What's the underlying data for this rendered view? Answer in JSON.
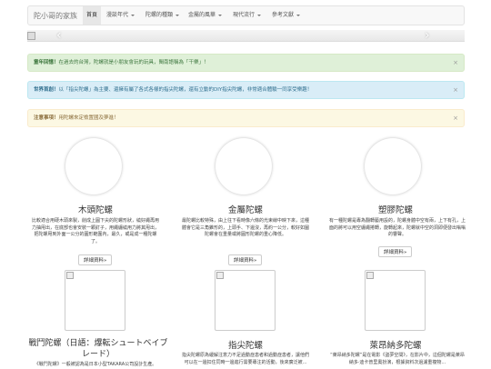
{
  "navbar": {
    "brand": "陀小哥的家族",
    "items": [
      {
        "label": "首頁",
        "dropdown": false,
        "active": true
      },
      {
        "label": "漫談年代",
        "dropdown": true
      },
      {
        "label": "陀螺的種類",
        "dropdown": true
      },
      {
        "label": "金屬的風華",
        "dropdown": true
      },
      {
        "label": "現代流行",
        "dropdown": true
      },
      {
        "label": "參考文獻",
        "dropdown": true
      }
    ]
  },
  "alerts": {
    "success": {
      "strong": "童年回憶！",
      "text": "在過去的台灣，陀螺就是小朋友會玩的玩具，閩南語稱為「干樂」！"
    },
    "info": {
      "strong": "世界首創！",
      "text": "以「指尖陀螺」為主要、還擁有屬了各式各樣的指尖陀螺，還有立動的DIY指尖陀螺，非常適合體驗一同享受樂趣！"
    },
    "warning": {
      "strong": "注意事項！",
      "text": "用陀螺來定檢置國及夢進！"
    }
  },
  "cards": [
    {
      "title": "木頭陀螺",
      "text": "比較適合用硬木頭來製，削成上圓下尖的陀螺形狀，繞好繩再用力抽甩出，在底部也會安裝一顆釘子，用繩纏繞用力將其甩出，把陀螺甩到外面一公分的圓形範圍內，最久，或是成一種陀螺了。",
      "button": "詳細資料»"
    },
    {
      "title": "金屬陀螺",
      "text": "最陀螺比較特殊，由上往下看時像六條的光束線中映下來，這種體會它是三角錐形的，上頭手、下邊沒，再約一公分，較好如圖陀螺會在重量或將圓形陀螺的重心降低。",
      "button": "詳細資料»"
    },
    {
      "title": "塑膠陀螺",
      "text": "有一種陀螺是專為翻轉藝用設的，陀螺身體中空有兩，上下有孔，上面的將可以用空纏繩捲轉，旋轉起來，陀螺就中空的洞即便發出嗡嗡的響聲。",
      "button": "詳細資料»"
    },
    {
      "title": "戰鬥陀螺（日語：爆転シュートベイブレード）",
      "text": "《戰鬥陀螺》一般被認為是日本小型TAKARA公司設計生產。"
    },
    {
      "title": "指尖陀螺",
      "text": "指尖陀螺原為緩解注意力不足過動症患者和過動症患者，讓他們可以在一邊扣住同時一邊進行需要專注的活動，後來廣泛被..."
    },
    {
      "title": "萊昂納多陀螺",
      "text": "“萊昂納多陀螺”是在電影《盜夢空間》，在影片中，這個陀螺是萊昂納多·迪卡普里奧扮演，根據資料次過濾重複物..."
    }
  ]
}
